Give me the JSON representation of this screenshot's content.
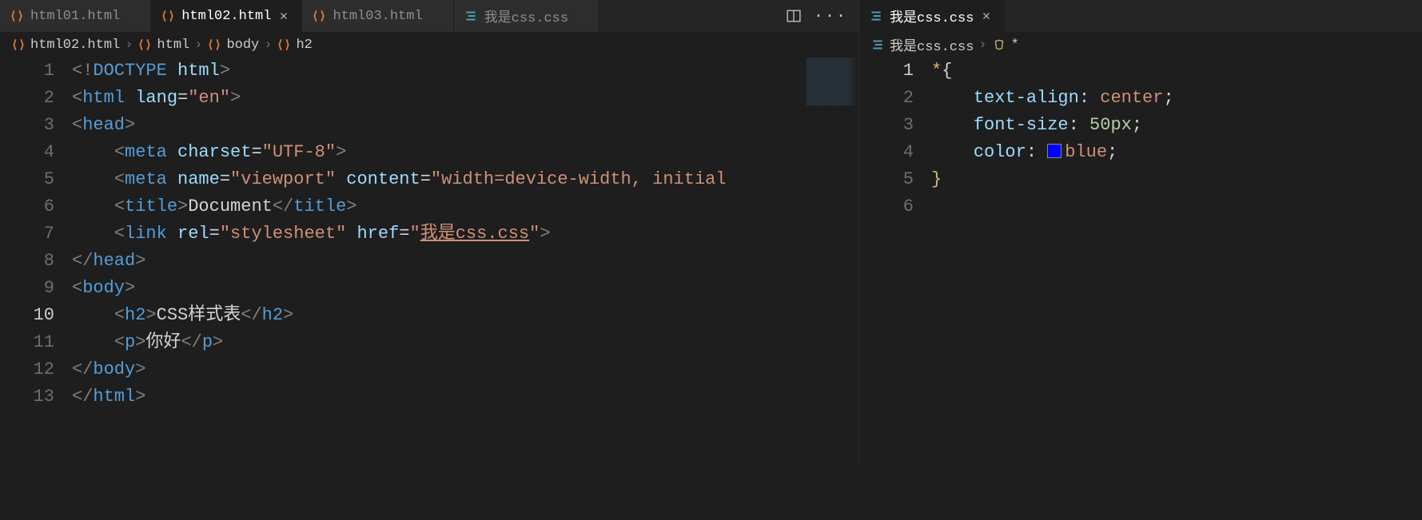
{
  "left": {
    "tabs": [
      {
        "label": "html01.html",
        "kind": "html",
        "active": false
      },
      {
        "label": "html02.html",
        "kind": "html",
        "active": true
      },
      {
        "label": "html03.html",
        "kind": "html",
        "active": false
      },
      {
        "label": "我是css.css",
        "kind": "css",
        "active": false
      }
    ],
    "breadcrumbs": [
      {
        "icon": "html",
        "label": "html02.html"
      },
      {
        "icon": "brace",
        "label": "html"
      },
      {
        "icon": "brace",
        "label": "body"
      },
      {
        "icon": "brace",
        "label": "h2"
      }
    ],
    "activeLine": 10,
    "lines": [
      {
        "n": "1",
        "tokens": [
          [
            "gy",
            "<!"
          ],
          [
            "tg",
            "DOCTYPE"
          ],
          [
            "tx",
            " "
          ],
          [
            "at",
            "html"
          ],
          [
            "gy",
            ">"
          ]
        ]
      },
      {
        "n": "2",
        "tokens": [
          [
            "gy",
            "<"
          ],
          [
            "tg",
            "html"
          ],
          [
            "tx",
            " "
          ],
          [
            "at",
            "lang"
          ],
          [
            "tx",
            "="
          ],
          [
            "st",
            "\"en\""
          ],
          [
            "gy",
            ">"
          ]
        ]
      },
      {
        "n": "3",
        "tokens": [
          [
            "gy",
            "<"
          ],
          [
            "tg",
            "head"
          ],
          [
            "gy",
            ">"
          ]
        ]
      },
      {
        "n": "4",
        "indent": 1,
        "tokens": [
          [
            "gy",
            "<"
          ],
          [
            "tg",
            "meta"
          ],
          [
            "tx",
            " "
          ],
          [
            "at",
            "charset"
          ],
          [
            "tx",
            "="
          ],
          [
            "st",
            "\"UTF-8\""
          ],
          [
            "gy",
            ">"
          ]
        ]
      },
      {
        "n": "5",
        "indent": 1,
        "tokens": [
          [
            "gy",
            "<"
          ],
          [
            "tg",
            "meta"
          ],
          [
            "tx",
            " "
          ],
          [
            "at",
            "name"
          ],
          [
            "tx",
            "="
          ],
          [
            "st",
            "\"viewport\""
          ],
          [
            "tx",
            " "
          ],
          [
            "at",
            "content"
          ],
          [
            "tx",
            "="
          ],
          [
            "st",
            "\"width=device-width, initial"
          ]
        ]
      },
      {
        "n": "6",
        "indent": 1,
        "tokens": [
          [
            "gy",
            "<"
          ],
          [
            "tg",
            "title"
          ],
          [
            "gy",
            ">"
          ],
          [
            "tx",
            "Document"
          ],
          [
            "gy",
            "</"
          ],
          [
            "tg",
            "title"
          ],
          [
            "gy",
            ">"
          ]
        ]
      },
      {
        "n": "7",
        "indent": 1,
        "tokens": [
          [
            "gy",
            "<"
          ],
          [
            "tg",
            "link"
          ],
          [
            "tx",
            " "
          ],
          [
            "at",
            "rel"
          ],
          [
            "tx",
            "="
          ],
          [
            "st",
            "\"stylesheet\""
          ],
          [
            "tx",
            " "
          ],
          [
            "at",
            "href"
          ],
          [
            "tx",
            "="
          ],
          [
            "st",
            "\""
          ],
          [
            "st uline",
            "我是css.css"
          ],
          [
            "st",
            "\""
          ],
          [
            "gy",
            ">"
          ]
        ]
      },
      {
        "n": "8",
        "tokens": [
          [
            "gy",
            "</"
          ],
          [
            "tg",
            "head"
          ],
          [
            "gy",
            ">"
          ]
        ]
      },
      {
        "n": "9",
        "tokens": [
          [
            "gy",
            "<"
          ],
          [
            "tg",
            "body"
          ],
          [
            "gy",
            ">"
          ]
        ]
      },
      {
        "n": "10",
        "indent": 1,
        "tokens": [
          [
            "gy",
            "<"
          ],
          [
            "tg",
            "h2"
          ],
          [
            "gy",
            ">"
          ],
          [
            "tx",
            "CSS样式表"
          ],
          [
            "gy",
            "</"
          ],
          [
            "tg",
            "h2"
          ],
          [
            "gy",
            ">"
          ]
        ]
      },
      {
        "n": "11",
        "indent": 1,
        "tokens": [
          [
            "gy",
            "<"
          ],
          [
            "tg",
            "p"
          ],
          [
            "gy",
            ">"
          ],
          [
            "tx",
            "你好"
          ],
          [
            "gy",
            "</"
          ],
          [
            "tg",
            "p"
          ],
          [
            "gy",
            ">"
          ]
        ]
      },
      {
        "n": "12",
        "tokens": [
          [
            "gy",
            "</"
          ],
          [
            "tg",
            "body"
          ],
          [
            "gy",
            ">"
          ]
        ]
      },
      {
        "n": "13",
        "tokens": [
          [
            "gy",
            "</"
          ],
          [
            "tg",
            "html"
          ],
          [
            "gy",
            ">"
          ]
        ]
      }
    ]
  },
  "right": {
    "tabs": [
      {
        "label": "我是css.css",
        "kind": "css",
        "active": true
      }
    ],
    "breadcrumbs": [
      {
        "icon": "css",
        "label": "我是css.css"
      },
      {
        "icon": "rule",
        "label": "*"
      }
    ],
    "activeLine": 1,
    "lines": [
      {
        "n": "1",
        "tokens": [
          [
            "ye",
            "*"
          ],
          [
            "tx",
            "{"
          ]
        ]
      },
      {
        "n": "2",
        "indent": 1,
        "tokens": [
          [
            "at",
            "text-align"
          ],
          [
            "tx",
            ": "
          ],
          [
            "st",
            "center"
          ],
          [
            "tx",
            ";"
          ]
        ]
      },
      {
        "n": "3",
        "indent": 1,
        "tokens": [
          [
            "at",
            "font-size"
          ],
          [
            "tx",
            ": "
          ],
          [
            "nm",
            "50px"
          ],
          [
            "tx",
            ";"
          ]
        ]
      },
      {
        "n": "4",
        "indent": 1,
        "tokens": [
          [
            "at",
            "color"
          ],
          [
            "tx",
            ": "
          ],
          [
            "swatch",
            ""
          ],
          [
            "st",
            "blue"
          ],
          [
            "tx",
            ";"
          ]
        ]
      },
      {
        "n": "5",
        "tokens": [
          [
            "ye",
            "}"
          ]
        ]
      },
      {
        "n": "6",
        "tokens": []
      }
    ]
  }
}
